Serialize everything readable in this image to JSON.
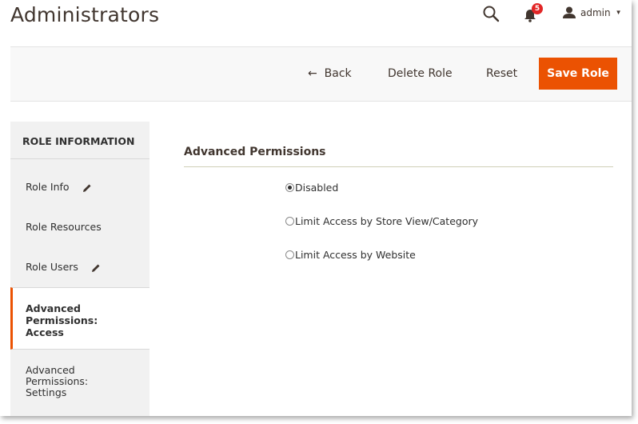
{
  "header": {
    "page_title": "Administrators",
    "notification_count": "5",
    "user_name": "admin"
  },
  "actions": {
    "back_label": "Back",
    "delete_label": "Delete Role",
    "reset_label": "Reset",
    "save_label": "Save Role"
  },
  "sidebar": {
    "title": "ROLE INFORMATION",
    "items": [
      {
        "label": "Role Info",
        "icon": "pencil-icon"
      },
      {
        "label": "Role Resources"
      },
      {
        "label": "Role Users",
        "icon": "pencil-icon"
      },
      {
        "label": "Advanced Permissions: Access",
        "active": true
      },
      {
        "label": "Advanced Permissions: Settings"
      }
    ]
  },
  "main": {
    "section_title": "Advanced Permissions",
    "options": [
      {
        "label": "Disabled",
        "checked": true
      },
      {
        "label": "Limit Access by Store View/Category",
        "checked": false
      },
      {
        "label": "Limit Access by Website",
        "checked": false
      }
    ]
  },
  "colors": {
    "accent": "#eb5202",
    "badge": "#e22626",
    "sidebar_bg": "#f1f1f1"
  }
}
